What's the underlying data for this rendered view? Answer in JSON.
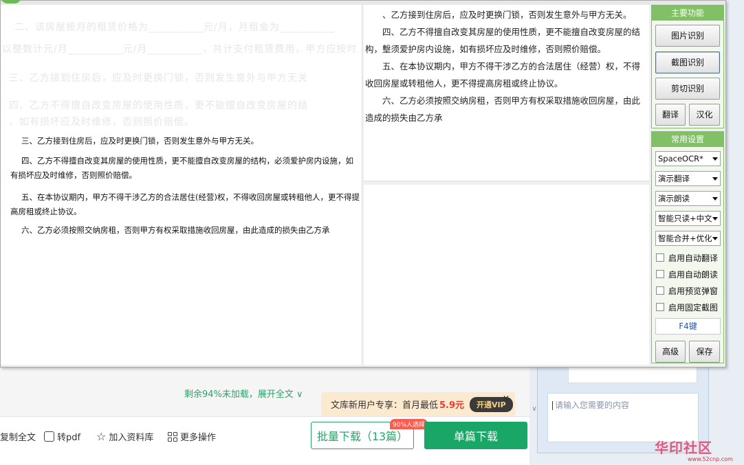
{
  "background_page": {
    "load_more_text": "剩余94%未加载，展开全文",
    "actions": [
      "复制全文",
      "转pdf",
      "加入资料库",
      "更多操作"
    ],
    "promo": {
      "text": "文库新用户专享：首月最低",
      "price": "5.9元",
      "vip_button": "开通VIP",
      "close": "✕"
    },
    "batch_download": "批量下载（13篇）",
    "batch_badge": "90%人选择",
    "single_download": "单篇下载",
    "chat_placeholder": "请输入您需要的内容",
    "watermark": "华印社区",
    "watermark_url": "www.52cnp.com"
  },
  "capture": {
    "faint_lines": [
      "二、该房屋按月的租赁价格为__________元/月，月租金为__________",
      "以整数计元/月__________元/月__________，共计支付租赁费用，甲方应按时",
      "三、乙方接到住房后，应及时更换门锁，否则发生意外与甲方无关",
      "四、乙方不得擅自改变房屋的使用性质，更不能擅自改变房屋的结",
      "，如有损坏应及时维修，否则照价赔偿。"
    ],
    "lines": [
      "三、乙方接到住房后，应及时更换门锁，否则发生意外与甲方无关。",
      "四、乙方不得擅自改变其房屋的使用性质，更不能擅自改变房屋的结构，必须爱护房内设施，如有损坏应及时维修，否则照价赔偿。",
      "五、在本协议期内，甲方不得干涉乙方的合法居住(经营)权，不得收回房屋或转租他人，更不得提高房租或终止协议。",
      "六、乙方必须按照交纳房租，否则甲方有权采取措施收回房屋，由此造成的损失由乙方承"
    ]
  },
  "result": {
    "paragraphs": [
      "、乙方接到住房后，应及时更换门锁，否则发生意外与甲方无关。",
      "四、乙方不得擅自改变其房屋的使用性质，更不能擅自改变房屋的结构，墼须爱护房内设施，如有损坏应及时维修，否则照价赔偿。",
      "五、在本协议期内，甲方不得干涉乙方的合法居住（经营）权，不得收回房屋或转租他人，更不得提高房租或终止协议。",
      "六、乙方必须按照交纳房租，否则甲方有权采取措施收回房屋，由此造成的损失由乙方承"
    ]
  },
  "panel": {
    "main_title": "主要功能",
    "btn_image_ocr": "图片识别",
    "btn_screenshot_ocr": "截图识别",
    "btn_clipboard_ocr": "剪切识别",
    "btn_translate": "翻译",
    "btn_localize": "汉化",
    "settings_title": "常用设置",
    "select_engine": "SpaceOCR*",
    "select_translate": "演示翻译",
    "select_read": "演示朗读",
    "select_smart": "智能只读+中文",
    "select_merge": "智能合并+优化",
    "chk_auto_translate": "启用自动翻译",
    "chk_auto_read": "启用自动朗读",
    "chk_preview": "启用预览弹窗",
    "chk_fixed_capture": "启用固定截图",
    "hotkey": "F4键",
    "btn_advanced": "高级",
    "btn_save": "保存"
  }
}
